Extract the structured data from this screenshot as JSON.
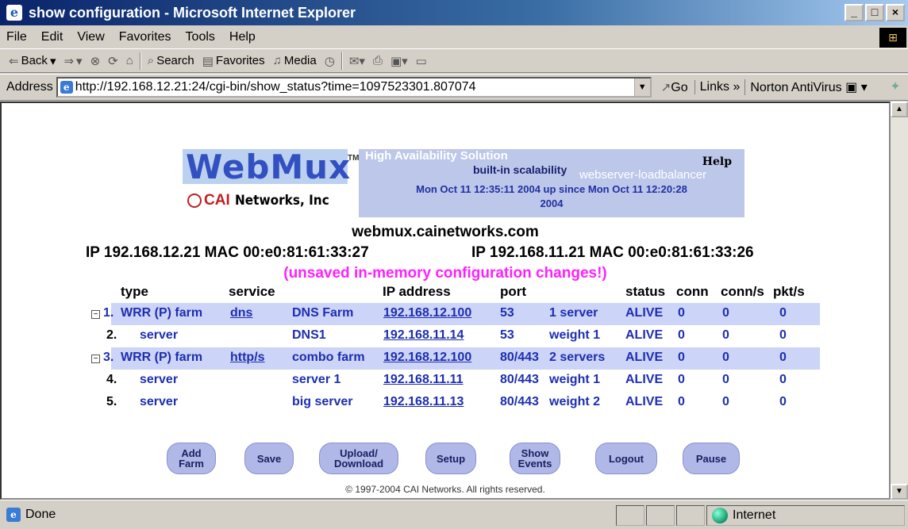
{
  "window": {
    "title": "show configuration - Microsoft Internet Explorer",
    "controls": {
      "minimize": "_",
      "maximize": "□",
      "close": "×"
    }
  },
  "menu": [
    "File",
    "Edit",
    "View",
    "Favorites",
    "Tools",
    "Help"
  ],
  "toolbar": {
    "back": "Back",
    "search": "Search",
    "favorites": "Favorites",
    "media": "Media"
  },
  "address": {
    "label": "Address",
    "url": "http://192.168.12.21:24/cgi-bin/show_status?time=1097523301.807074",
    "go": "Go",
    "links": "Links",
    "norton": "Norton AntiVirus"
  },
  "banner": {
    "logo": "WebMux",
    "tm": "TM",
    "company_mark": "CAI",
    "company_rest": "Networks, Inc",
    "tagline": "High Availability Solution",
    "builtin": "built-in scalability",
    "loadbalancer": "webserver-loadbalancer",
    "help": "Help",
    "status_line1": "Mon Oct 11 12:35:11 2004 up since Mon Oct 11 12:20:28",
    "status_line2": "2004"
  },
  "host": {
    "name": "webmux.cainetworks.com",
    "left_ip": "IP 192.168.12.21  MAC 00:e0:81:61:33:27",
    "right_ip": "IP 192.168.11.21  MAC 00:e0:81:61:33:26",
    "warning": "(unsaved in-memory configuration changes!)"
  },
  "table": {
    "headers": {
      "type": "type",
      "service": "service",
      "ip": "IP address",
      "port": "port",
      "status": "status",
      "conn": "conn",
      "conns": "conn/s",
      "pkts": "pkt/s"
    },
    "rows": [
      {
        "num": "1.",
        "type": "WRR (P) farm",
        "service": "dns",
        "name": "DNS Farm",
        "ip": "192.168.12.100",
        "port": "53",
        "detail": "1 server",
        "status": "ALIVE",
        "conn": "0",
        "conns": "0",
        "pkts": "0"
      },
      {
        "num": "2.",
        "type": "server",
        "service": "",
        "name": "DNS1",
        "ip": "192.168.11.14",
        "port": "53",
        "detail": "weight 1",
        "status": "ALIVE",
        "conn": "0",
        "conns": "0",
        "pkts": "0"
      },
      {
        "num": "3.",
        "type": "WRR (P) farm",
        "service": "http/s",
        "name": "combo farm",
        "ip": "192.168.12.100",
        "port": "80/443",
        "detail": "2 servers",
        "status": "ALIVE",
        "conn": "0",
        "conns": "0",
        "pkts": "0"
      },
      {
        "num": "4.",
        "type": "server",
        "service": "",
        "name": "server 1",
        "ip": "192.168.11.11",
        "port": "80/443",
        "detail": "weight 1",
        "status": "ALIVE",
        "conn": "0",
        "conns": "0",
        "pkts": "0"
      },
      {
        "num": "5.",
        "type": "server",
        "service": "",
        "name": "big server",
        "ip": "192.168.11.13",
        "port": "80/443",
        "detail": "weight 2",
        "status": "ALIVE",
        "conn": "0",
        "conns": "0",
        "pkts": "0"
      }
    ],
    "collapse_symbol": "−"
  },
  "buttons": {
    "add_farm_1": "Add",
    "add_farm_2": "Farm",
    "save": "Save",
    "upload_1": "Upload/",
    "upload_2": "Download",
    "setup": "Setup",
    "show_events_1": "Show",
    "show_events_2": "Events",
    "logout": "Logout",
    "pause": "Pause"
  },
  "footer": "© 1997-2004 CAI Networks. All rights reserved.",
  "statusbar": {
    "text": "Done",
    "zone": "Internet"
  },
  "colors": {
    "link": "#1d2fb0",
    "warning": "#ff20ff",
    "row_highlight": "#ccd4f8",
    "button": "#b0b8e8"
  }
}
